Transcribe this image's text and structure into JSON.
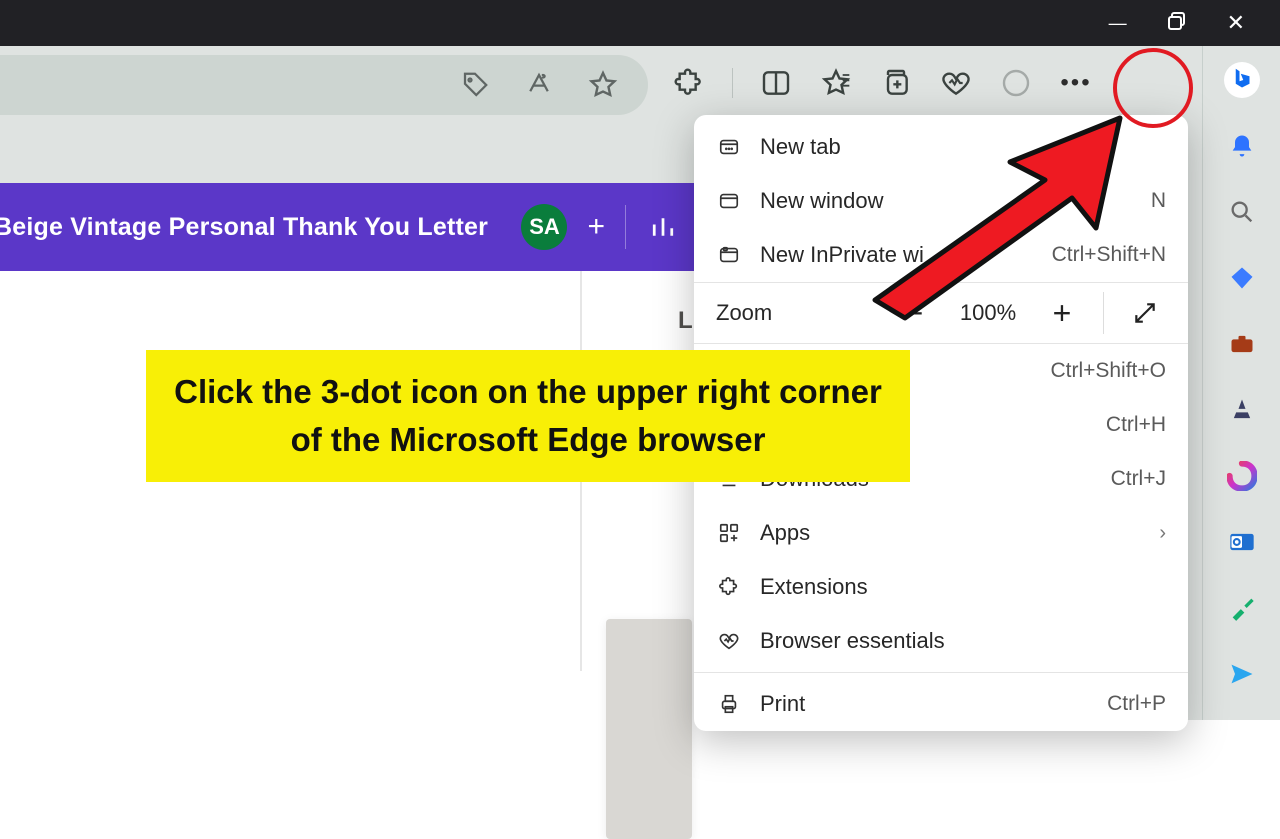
{
  "window": {
    "avatar_initials": "SA",
    "page_title_fragment": "Beige Vintage Personal Thank You Letter",
    "letter_peek": "L"
  },
  "menu": {
    "items": [
      {
        "label": "New tab",
        "shortcut": ""
      },
      {
        "label": "New window",
        "shortcut": "N"
      },
      {
        "label": "New InPrivate wi",
        "shortcut": "Ctrl+Shift+N"
      }
    ],
    "zoom": {
      "label": "Zoom",
      "value": "100%"
    },
    "after_zoom": [
      {
        "label": "",
        "shortcut": "Ctrl+Shift+O"
      },
      {
        "label": "",
        "shortcut": "Ctrl+H"
      },
      {
        "label": "Downloads",
        "shortcut": "Ctrl+J"
      },
      {
        "label": "Apps",
        "shortcut": "",
        "has_chevron": true
      },
      {
        "label": "Extensions",
        "shortcut": ""
      },
      {
        "label": "Browser essentials",
        "shortcut": ""
      },
      {
        "label": "Print",
        "shortcut": "Ctrl+P"
      }
    ]
  },
  "callout_text": "Click the 3-dot icon on the upper right corner of the Microsoft Edge browser"
}
